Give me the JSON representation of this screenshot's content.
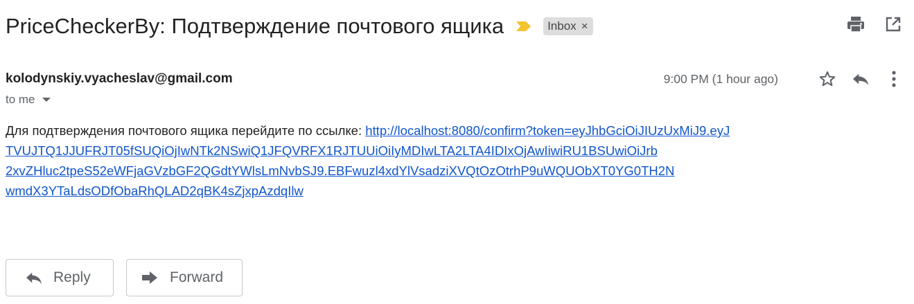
{
  "email": {
    "subject": "PriceCheckerBy: Подтверждение почтового ящика",
    "label": "Inbox",
    "label_remove": "×",
    "sender": "kolodynskiy.vyacheslav@gmail.com",
    "recipient": "to me",
    "time": "9:00 PM (1 hour ago)",
    "body_prefix": "Для подтверждения почтового ящика перейдите по ссылке: ",
    "link_lines": [
      "http://localhost:8080/confirm?token=eyJhbGciOiJIUzUxMiJ9.eyJ",
      "TVUJTQ1JJUFRJT05fSUQiOjIwNTk2NSwiQ1JFQVRFX1RJTUUiOiIyMDIwLTA2LTA4IDIxOjAwIiwiRU1BSUwiOiJrb",
      "2xvZHluc2tpeS52eWFjaGVzbGF2QGdtYWlsLmNvbSJ9.EBFwuzl4xdYlVsadziXVQtOzOtrhP9uWQUObXT0YG0TH2N",
      "wmdX3YTaLdsODfObaRhQLAD2qBK4sZjxpAzdqIlw"
    ]
  },
  "actions": {
    "reply_label": "Reply",
    "forward_label": "Forward"
  },
  "icons": {
    "importance": "importance-marker-icon",
    "print": "print-icon",
    "open_new_window": "open-in-new-window-icon",
    "star": "star-icon",
    "reply": "reply-icon",
    "more": "more-vertical-icon",
    "forward": "forward-icon"
  },
  "colors": {
    "importance": "#f4c430",
    "link": "#1155cc",
    "chip_bg": "#dddddd",
    "icon_gray": "#5f6368"
  }
}
